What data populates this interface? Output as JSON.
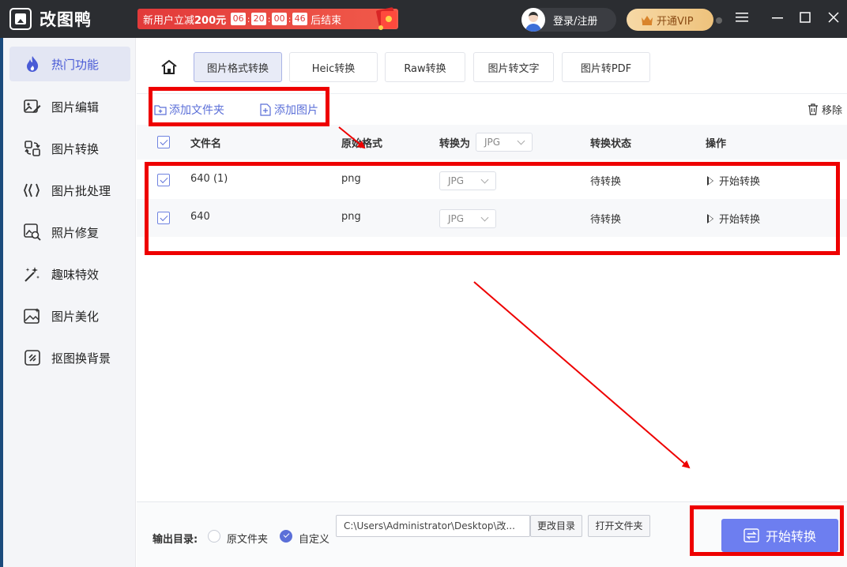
{
  "app": {
    "title": "改图鸭",
    "promo_text_prefix": "新用户立减",
    "promo_amount": "200元",
    "timer": [
      "06",
      "20",
      "00",
      "46"
    ],
    "promo_suffix": "后结束",
    "login_label": "登录/注册",
    "vip_label": "开通VIP",
    "window_controls": [
      "menu-icon",
      "minimize-icon",
      "maximize-icon",
      "close-icon"
    ]
  },
  "sidebar": {
    "items": [
      {
        "label": "热门功能",
        "icon": "flame-icon",
        "active": true
      },
      {
        "label": "图片编辑",
        "icon": "image-edit-icon"
      },
      {
        "label": "图片转换",
        "icon": "convert-icon"
      },
      {
        "label": "图片批处理",
        "icon": "batch-icon"
      },
      {
        "label": "照片修复",
        "icon": "photo-repair-icon"
      },
      {
        "label": "趣味特效",
        "icon": "magic-wand-icon"
      },
      {
        "label": "图片美化",
        "icon": "beautify-icon"
      },
      {
        "label": "抠图换背景",
        "icon": "cutout-icon"
      }
    ]
  },
  "tabs": [
    {
      "label": "图片格式转换",
      "active": true
    },
    {
      "label": "Heic转换"
    },
    {
      "label": "Raw转换"
    },
    {
      "label": "图片转文字"
    },
    {
      "label": "图片转PDF"
    }
  ],
  "toolbar": {
    "add_folder": "添加文件夹",
    "add_image": "添加图片",
    "remove": "移除"
  },
  "table": {
    "headers": {
      "name": "文件名",
      "format": "原始格式",
      "convert_to": "转换为",
      "status": "转换状态",
      "action": "操作"
    },
    "header_select_value": "JPG",
    "rows": [
      {
        "name": "640 (1)",
        "format": "png",
        "target": "JPG",
        "status": "待转换",
        "action": "开始转换",
        "checked": true
      },
      {
        "name": "640",
        "format": "png",
        "target": "JPG",
        "status": "待转换",
        "action": "开始转换",
        "checked": true
      }
    ]
  },
  "footer": {
    "output_label": "输出目录:",
    "option_original": "原文件夹",
    "option_custom": "自定义",
    "selected_option": "自定义",
    "path": "C:\\Users\\Administrator\\Desktop\\改...",
    "change_dir": "更改目录",
    "open_folder": "打开文件夹",
    "start": "开始转换"
  },
  "colors": {
    "accent": "#5b6fd8",
    "annotation": "#ee0000",
    "titlebar": "#2b2d31",
    "promo": "#e23a3a"
  }
}
